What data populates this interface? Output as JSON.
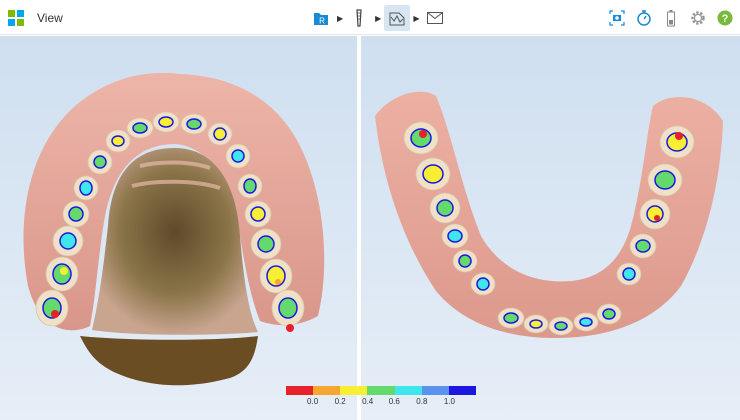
{
  "toolbar": {
    "view_label": "View",
    "scan_badge": "R"
  },
  "legend": {
    "labels": [
      "0.0",
      "0.2",
      "0.4",
      "0.6",
      "0.8",
      "1.0"
    ],
    "colors": [
      "#e8202a",
      "#f6a631",
      "#f8ee34",
      "#64d96c",
      "#3fe6ec",
      "#5b92f0",
      "#1c17e0"
    ]
  },
  "colors": {
    "accent": "#1a8ad4",
    "gum": "#e3a59b",
    "tooth": "#efe0c8",
    "viewport_bg": "#d7e5f3"
  }
}
